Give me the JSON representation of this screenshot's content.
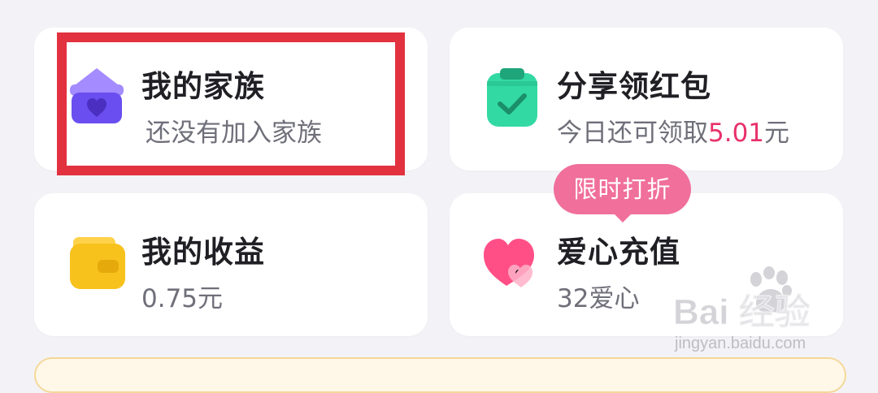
{
  "cards": {
    "family": {
      "title": "我的家族",
      "subtitle": "还没有加入家族",
      "icon": "family-house-heart-icon",
      "highlighted": true,
      "highlight_color": "#e2323f"
    },
    "share": {
      "title": "分享领红包",
      "subtitle_prefix": "今日还可领取",
      "amount": "5.01",
      "unit": "元",
      "icon": "clipboard-check-icon",
      "amount_color": "#e8306a"
    },
    "income": {
      "title": "我的收益",
      "subtitle": "0.75元",
      "icon": "wallet-icon"
    },
    "recharge": {
      "title": "爱心充值",
      "subtitle": "32爱心",
      "icon": "hearts-icon",
      "badge": "限时打折",
      "badge_color": "#f06f9b"
    }
  },
  "watermark": {
    "logo": "Bai 经验",
    "url": "jingyan.baidu.com"
  }
}
